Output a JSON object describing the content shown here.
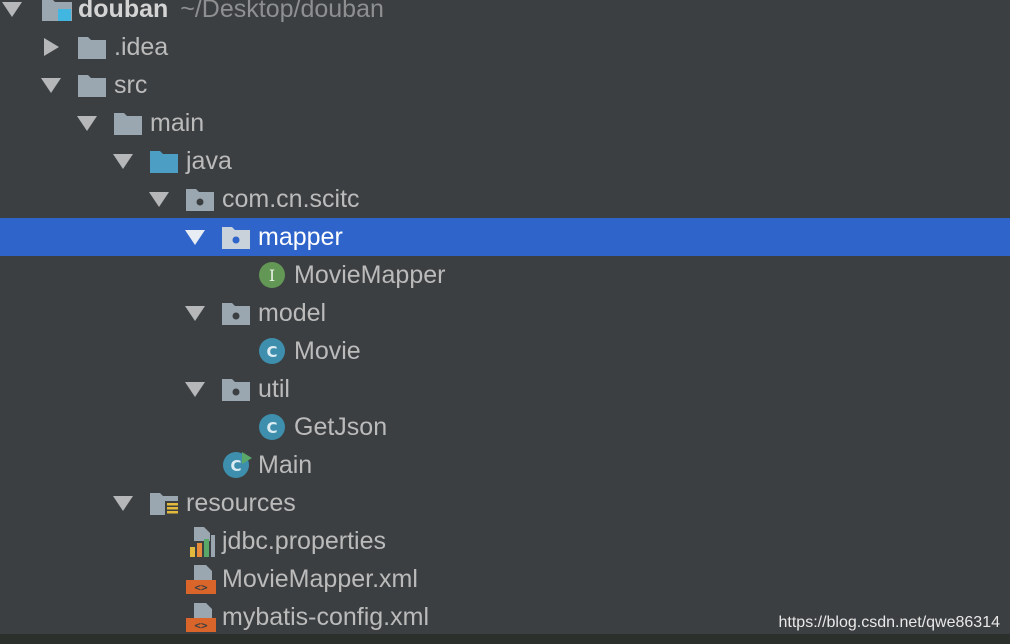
{
  "project": {
    "name": "douban",
    "path": "~/Desktop/douban"
  },
  "tree": {
    "idea": ".idea",
    "src": "src",
    "main": "main",
    "java": "java",
    "package": "com.cn.scitc",
    "mapper": "mapper",
    "movie_mapper": "MovieMapper",
    "model": "model",
    "movie": "Movie",
    "util": "util",
    "get_json": "GetJson",
    "main_class": "Main",
    "resources": "resources",
    "jdbc": "jdbc.properties",
    "movie_mapper_xml": "MovieMapper.xml",
    "mybatis_config": "mybatis-config.xml"
  },
  "icons": {
    "interface_letter": "I",
    "class_letter": "C",
    "xml_letter": "<>"
  },
  "colors": {
    "background": "#3c3f41",
    "selection": "#2f65ca",
    "folder": "#9aa7b0",
    "source_folder": "#4c9ec4",
    "interface": "#629755",
    "class": "#3d8fad"
  },
  "watermark": "https://blog.csdn.net/qwe86314"
}
